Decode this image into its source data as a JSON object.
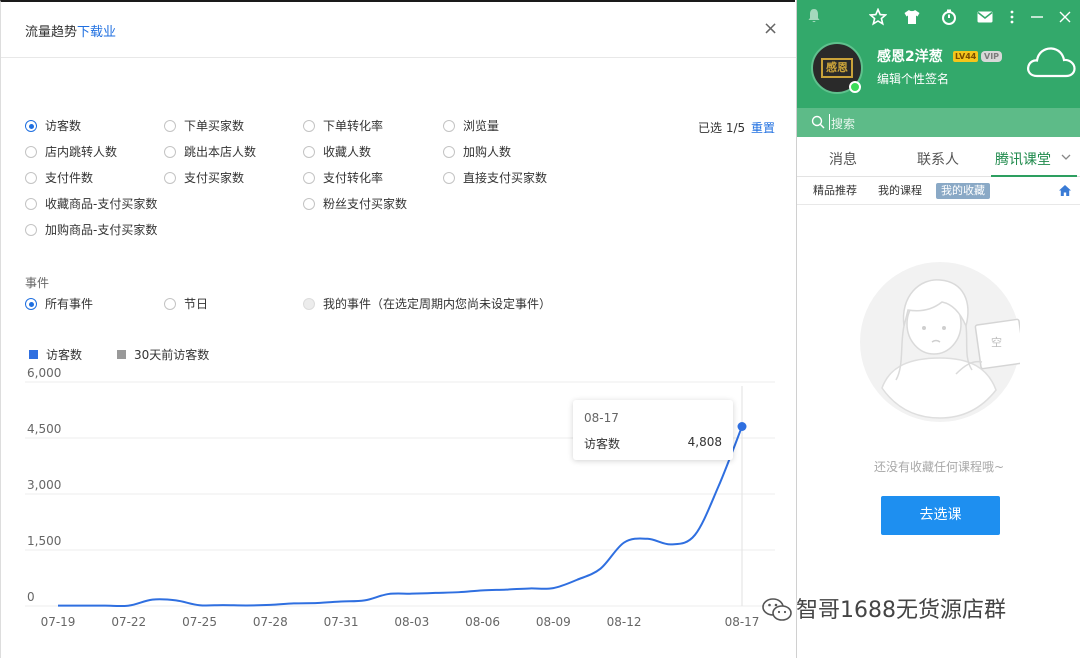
{
  "dialog": {
    "title": "流量趋势",
    "title_link": "下载业",
    "close_label": "×",
    "selected_count": "已选 1/5",
    "reset_label": "重置",
    "metrics": [
      {
        "label": "访客数",
        "checked": true
      },
      {
        "label": "下单买家数",
        "checked": false
      },
      {
        "label": "下单转化率",
        "checked": false
      },
      {
        "label": "浏览量",
        "checked": false
      },
      {
        "label": "店内跳转人数",
        "checked": false
      },
      {
        "label": "跳出本店人数",
        "checked": false
      },
      {
        "label": "收藏人数",
        "checked": false
      },
      {
        "label": "加购人数",
        "checked": false
      },
      {
        "label": "支付件数",
        "checked": false
      },
      {
        "label": "支付买家数",
        "checked": false
      },
      {
        "label": "支付转化率",
        "checked": false
      },
      {
        "label": "直接支付买家数",
        "checked": false
      },
      {
        "label": "收藏商品-支付买家数",
        "checked": false
      },
      {
        "label": "粉丝支付买家数",
        "checked": false
      },
      {
        "label": "加购商品-支付买家数",
        "checked": false
      }
    ],
    "events_label": "事件",
    "events": [
      {
        "label": "所有事件",
        "checked": true
      },
      {
        "label": "节日",
        "checked": false
      },
      {
        "label": "我的事件（在选定周期内您尚未设定事件）",
        "checked": false,
        "disabled": true
      }
    ]
  },
  "chart_data": {
    "type": "line",
    "series": [
      {
        "name": "访客数",
        "color": "#2f6fe0",
        "x": [
          "07-19",
          "07-20",
          "07-21",
          "07-22",
          "07-23",
          "07-24",
          "07-25",
          "07-26",
          "07-27",
          "07-28",
          "07-29",
          "07-30",
          "07-31",
          "08-01",
          "08-02",
          "08-03",
          "08-04",
          "08-05",
          "08-06",
          "08-07",
          "08-08",
          "08-09",
          "08-10",
          "08-11",
          "08-12",
          "08-13",
          "08-14",
          "08-15",
          "08-16",
          "08-17"
        ],
        "values": [
          10,
          10,
          10,
          10,
          170,
          150,
          20,
          25,
          15,
          30,
          70,
          80,
          120,
          150,
          320,
          330,
          350,
          370,
          420,
          440,
          470,
          480,
          700,
          1000,
          1700,
          1800,
          1650,
          1900,
          3200,
          4808
        ]
      }
    ],
    "legend": [
      {
        "label": "访客数",
        "color": "#2f6fe0"
      },
      {
        "label": "30天前访客数",
        "color": "#999999"
      }
    ],
    "x_tick_labels": [
      "07-19",
      "07-22",
      "07-25",
      "07-28",
      "07-31",
      "08-03",
      "08-06",
      "08-09",
      "08-12",
      "08-17"
    ],
    "y_ticks": [
      0,
      1500,
      3000,
      4500,
      6000
    ],
    "y_tick_labels": [
      "0",
      "1,500",
      "3,000",
      "4,500",
      "6,000"
    ],
    "ylim": [
      0,
      6000
    ],
    "grid": true,
    "tooltip": {
      "date": "08-17",
      "series": "访客数",
      "value": "4,808"
    }
  },
  "watermark": "智哥1688无货源店群",
  "qq": {
    "nickname": "感恩2洋葱",
    "level_badge": "LV44",
    "vip_badge": "VIP",
    "signature": "编辑个性签名",
    "avatar_text": "感恩",
    "search_placeholder": "搜索",
    "tabs": [
      "消息",
      "联系人",
      "腾讯课堂"
    ],
    "active_tab": "腾讯课堂",
    "subtabs": [
      "精品推荐",
      "我的课程",
      "我的收藏"
    ],
    "active_subtab": "我的收藏",
    "empty_badge": "空",
    "empty_text": "还没有收藏任何课程哦~",
    "button_label": "去选课",
    "icons": [
      "bell-icon",
      "star-icon",
      "shirt-icon",
      "timer-icon",
      "mail-icon",
      "more-icon",
      "minimize-icon",
      "close-icon",
      "cloud-icon",
      "search-icon",
      "home-icon",
      "chevron-down-icon"
    ]
  }
}
